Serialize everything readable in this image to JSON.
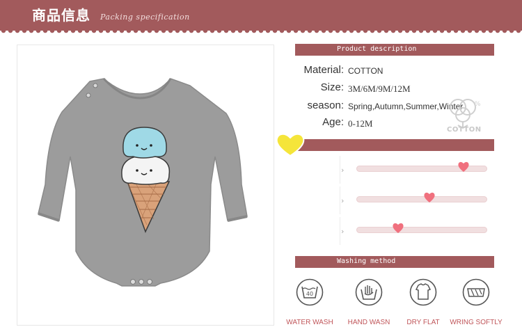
{
  "header": {
    "title": "商品信息",
    "subtitle": "Packing specification"
  },
  "sections": {
    "product_description": "Product description",
    "washing_method": "Washing method"
  },
  "specs": [
    {
      "label": "Material",
      "separator": ":",
      "value": "COTTON"
    },
    {
      "label": "Size",
      "separator": ":",
      "value": "3M/6M/9M/12M"
    },
    {
      "label": "season",
      "separator": ":",
      "value": "Spring,Autumn,Summer,Winter"
    },
    {
      "label": "Age",
      "separator": ":",
      "value": "0-12M"
    }
  ],
  "cotton_badge": "COTTON",
  "sliders": [
    {
      "level": 0.82
    },
    {
      "level": 0.56
    },
    {
      "level": 0.32
    }
  ],
  "washing": [
    {
      "icon": "water-wash-icon",
      "label": "WATER WASH",
      "text": "40"
    },
    {
      "icon": "hand-wash-icon",
      "label": "HAND WASN"
    },
    {
      "icon": "dry-flat-icon",
      "label": "DRY FLAT"
    },
    {
      "icon": "wring-softly-icon",
      "label": "WRING SOFTLY"
    }
  ],
  "colors": {
    "accent": "#a25a5c",
    "heart": "#f0707e",
    "yellow_heart": "#f5e53a",
    "caption": "#c0565a",
    "garment": "#9b9b9b"
  }
}
